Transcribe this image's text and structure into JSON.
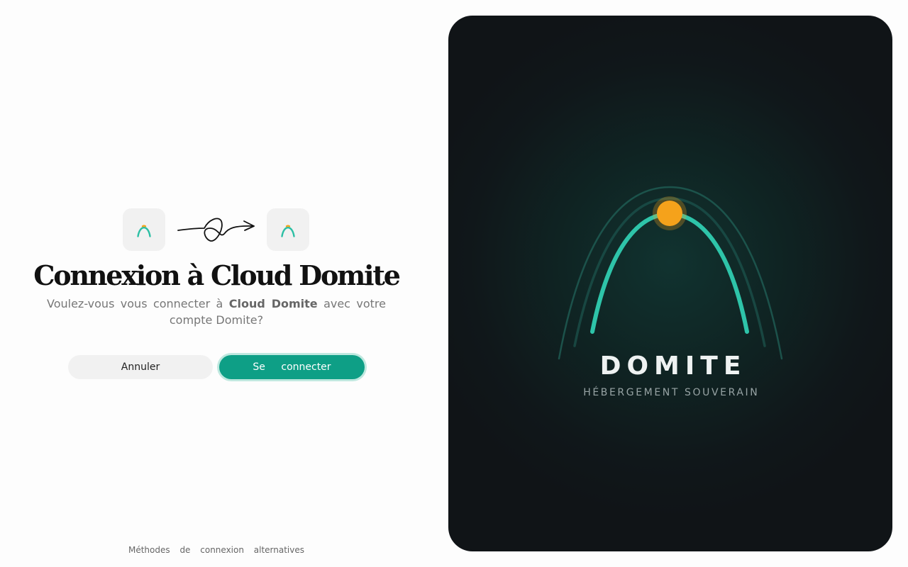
{
  "consent": {
    "title": "Connexion à Cloud Domite",
    "subtitle_prefix": "Voulez-vous vous connecter à",
    "subtitle_app": "Cloud Domite",
    "subtitle_suffix": "avec votre compte Domite?",
    "cancel_label": "Annuler",
    "connect_label": "Se connecter",
    "alt_methods_label": "Méthodes de connexion alternatives",
    "icons": {
      "source_app": "domite-arch-icon",
      "arrow": "squiggle-arrow-icon",
      "target_app": "domite-arch-icon"
    }
  },
  "brand": {
    "name": "DOMITE",
    "tagline": "HÉBERGEMENT SOUVERAIN",
    "logo": "domite-arch-logo"
  },
  "colors": {
    "accent": "#0e9f86",
    "arch": "#2ec4a9",
    "dot": "#f5a21b",
    "panel": "#101417"
  }
}
